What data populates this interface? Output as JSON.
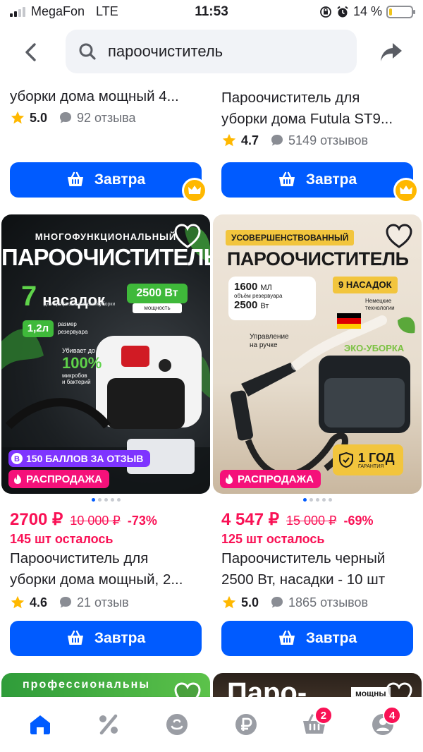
{
  "status_bar": {
    "carrier": "MegaFon",
    "network": "LTE",
    "time": "11:53",
    "battery": "14 %",
    "battery_level": 0.14
  },
  "search": {
    "query": "пароочиститель"
  },
  "products_top": [
    {
      "title_line_1": "уборки дома мощный 4...",
      "rating": "5.0",
      "reviews": "92 отзыва",
      "button_label": "Завтра"
    },
    {
      "title_line_1": "Пароочиститель для",
      "title_line_2": "уборки дома Futula ST9...",
      "rating": "4.7",
      "reviews": "5149 отзывов",
      "button_label": "Завтра"
    }
  ],
  "products": [
    {
      "image": {
        "headline_small": "МНОГОФУНКЦИОНАЛЬНЫЙ",
        "headline": "ПАРООЧИСТИТЕЛЬ",
        "attachments_number": "7",
        "attachments_word": "насадок",
        "attachments_sub": "для профессиональной уборки",
        "power": "2500 Вт",
        "power_sub": "мощность",
        "tank": "1,2л",
        "tank_label_1": "размер",
        "tank_label_2": "резервуара",
        "kill_line_1": "Убивает до",
        "kill_percent": "100%",
        "kill_line_2": "микробов",
        "kill_line_3": "и бактерий"
      },
      "bonus_badge": "150 БАЛЛОВ ЗА ОТЗЫВ",
      "sale_badge": "РАСПРОДАЖА",
      "price": "2700 ₽",
      "old_price": "10 000 ₽",
      "discount": "-73%",
      "stock": "145 шт осталось",
      "title_line_1": "Пароочиститель для",
      "title_line_2": "уборки дома мощный, 2...",
      "rating": "4.6",
      "reviews": "21 отзыв",
      "button_label": "Завтра"
    },
    {
      "image": {
        "ribbon": "УСОВЕРШЕНСТВОВАННЫЙ",
        "headline": "ПАРООЧИСТИТЕЛЬ",
        "volume": "1600",
        "volume_unit": "МЛ",
        "volume_sub": "объём резервуара",
        "power": "2500",
        "power_unit": "Вт",
        "attachments": "9 НАСАДОК",
        "german_1": "Немецкие",
        "german_2": "технологии",
        "handle_1": "Управление",
        "handle_2": "на ручке",
        "eco": "ЭКО-УБОРКА",
        "warranty": "1 ГОД",
        "warranty_sub": "ГАРАНТИЯ"
      },
      "sale_badge": "РАСПРОДАЖА",
      "price": "4 547 ₽",
      "old_price": "15 000 ₽",
      "discount": "-69%",
      "stock": "125 шт осталось",
      "title_line_1": "Пароочиститель черный",
      "title_line_2": "2500 Вт, насадки - 10 шт",
      "rating": "5.0",
      "reviews": "1865 отзывов",
      "button_label": "Завтра"
    }
  ],
  "products_bottom_peek": [
    {
      "image_text": "профессиональны"
    },
    {
      "image_text_1": "Паро-",
      "image_text_2": "мощны"
    }
  ],
  "bottom_nav": {
    "cart_badge": "2",
    "profile_badge": "4"
  },
  "colors": {
    "accent": "#005bff",
    "price": "#f91155",
    "star": "#ffb800"
  }
}
